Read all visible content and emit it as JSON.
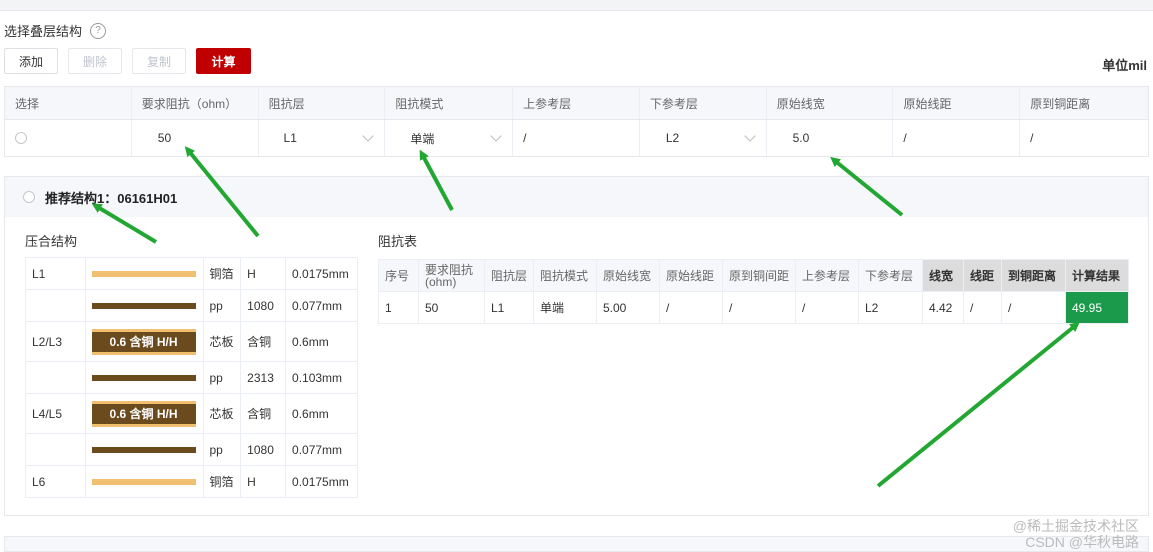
{
  "section": {
    "title": "选择叠层结构",
    "help_icon": "?"
  },
  "toolbar": {
    "add": "添加",
    "delete": "删除",
    "copy": "复制",
    "calc": "计算"
  },
  "unit": "单位mil",
  "params": {
    "headers": [
      "选择",
      "要求阻抗（ohm）",
      "阻抗层",
      "阻抗模式",
      "上参考层",
      "下参考层",
      "原始线宽",
      "原始线距",
      "原到铜距离"
    ],
    "row": {
      "impedance": "50",
      "layer": "L1",
      "mode": "单端",
      "upper_ref": "/",
      "lower_ref": "L2",
      "width": "5.0",
      "spacing": "/",
      "copper_dist": "/"
    }
  },
  "recommend": {
    "title": "推荐结构1：06161H01"
  },
  "stack": {
    "title": "压合结构",
    "rows": [
      {
        "layer": "L1",
        "kind": "foil",
        "bar_label": "",
        "material": "铜箔",
        "spec": "H",
        "thickness": "0.0175mm"
      },
      {
        "layer": "",
        "kind": "pp",
        "bar_label": "",
        "material": "pp",
        "spec": "1080",
        "thickness": "0.077mm"
      },
      {
        "layer": "L2/L3",
        "kind": "core",
        "bar_label": "0.6 含铜 H/H",
        "material": "芯板",
        "spec": "含铜",
        "thickness": "0.6mm"
      },
      {
        "layer": "",
        "kind": "pp",
        "bar_label": "",
        "material": "pp",
        "spec": "2313",
        "thickness": "0.103mm"
      },
      {
        "layer": "L4/L5",
        "kind": "core",
        "bar_label": "0.6 含铜 H/H",
        "material": "芯板",
        "spec": "含铜",
        "thickness": "0.6mm"
      },
      {
        "layer": "",
        "kind": "pp",
        "bar_label": "",
        "material": "pp",
        "spec": "1080",
        "thickness": "0.077mm"
      },
      {
        "layer": "L6",
        "kind": "foil",
        "bar_label": "",
        "material": "铜箔",
        "spec": "H",
        "thickness": "0.0175mm"
      }
    ]
  },
  "impedance_table": {
    "title": "阻抗表",
    "headers": [
      "序号",
      "要求阻抗(ohm)",
      "阻抗层",
      "阻抗模式",
      "原始线宽",
      "原始线距",
      "原到铜间距",
      "上参考层",
      "下参考层",
      "线宽",
      "线距",
      "到铜距离",
      "计算结果"
    ],
    "row": [
      "1",
      "50",
      "L1",
      "单端",
      "5.00",
      "/",
      "/",
      "/",
      "L2",
      "4.42",
      "/",
      "/",
      "49.95"
    ]
  },
  "watermark": {
    "line1": "@稀土掘金技术社区",
    "line2": "CSDN @华秋电路"
  },
  "colors": {
    "calc_button": "#c00000",
    "result_cell": "#1a9a4a",
    "arrow": "#22a832",
    "foil": "#f0c070",
    "pp": "#6b4a1e"
  }
}
